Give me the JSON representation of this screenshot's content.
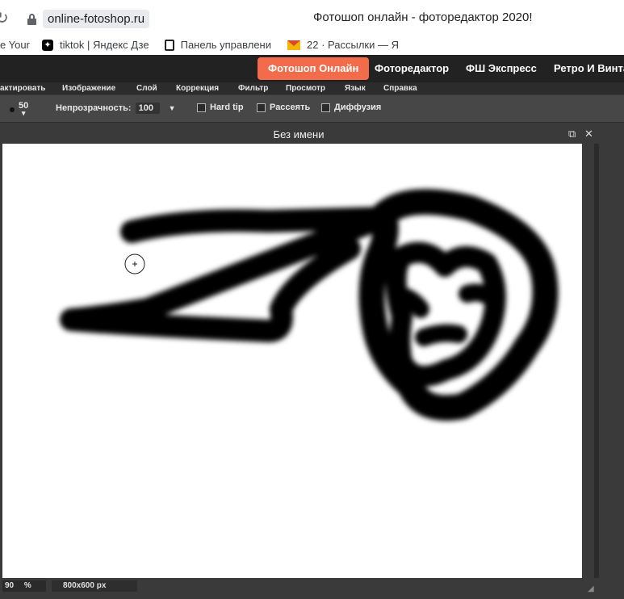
{
  "browser": {
    "url": "online-fotoshop.ru",
    "tab_title": "Фотошоп онлайн - фотоpедактоp 2020!",
    "bookmarks": [
      {
        "label": "e Your",
        "icon": "page-icon"
      },
      {
        "label": "tiktok | Яндекс Дзе",
        "icon": "sparkle-icon"
      },
      {
        "label": "Панель управлени",
        "icon": "panel-icon"
      },
      {
        "label": "22 · Рассылки — Я",
        "icon": "mail-icon"
      }
    ]
  },
  "nav": {
    "items": [
      {
        "label": "Фотошоп Онлайн",
        "active": true
      },
      {
        "label": "Фоторедактор"
      },
      {
        "label": "ФШ Экспресс"
      },
      {
        "label": "Ретро И Винта"
      }
    ]
  },
  "menu": {
    "items": [
      "актировать",
      "Изображение",
      "Слой",
      "Коррекция",
      "Фильтр",
      "Просмотр",
      "Язык",
      "Справка"
    ]
  },
  "toolbar": {
    "brush_size_value": "50",
    "opacity_label": "Непрозрачность:",
    "opacity_value": "100",
    "hard_tip_label": "Hard tip",
    "scatter_label": "Рассеять",
    "diffusion_label": "Диффузия"
  },
  "document": {
    "title": "Без имени",
    "zoom_value": "90",
    "zoom_unit": "%",
    "size_text": "800x600 px"
  },
  "colors": {
    "accent": "#f26b4b",
    "nav_bg": "#222222",
    "workspace_bg": "#3a3a3a",
    "canvas_bg": "#ffffff",
    "stroke": "#000000"
  }
}
